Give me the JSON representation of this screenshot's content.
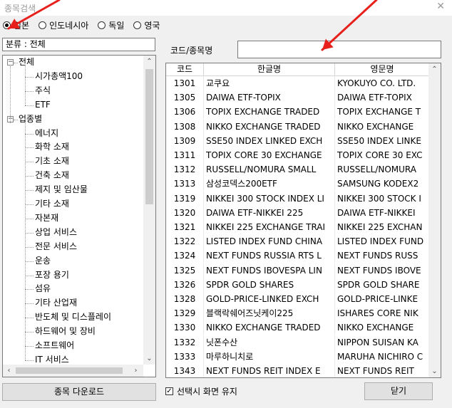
{
  "window": {
    "title": "종목검색"
  },
  "country_radios": [
    {
      "label": "일본",
      "selected": true
    },
    {
      "label": "인도네시아",
      "selected": false
    },
    {
      "label": "독일",
      "selected": false
    },
    {
      "label": "영국",
      "selected": false
    }
  ],
  "category_label": "분류 : 전체",
  "tree": {
    "groups": [
      {
        "label": "전체",
        "expander": "−",
        "children": [
          "시가총액100",
          "주식",
          "ETF"
        ]
      },
      {
        "label": "업종별",
        "expander": "−",
        "children": [
          "에너지",
          "화학 소재",
          "기초 소재",
          "건축 소재",
          "제지 및 임산물",
          "기타 소재",
          "자본재",
          "상업 서비스",
          "전문 서비스",
          "운송",
          "포장 용기",
          "섬유",
          "기타 산업재",
          "반도체 및 디스플레이",
          "하드웨어 및 장비",
          "소프트웨어",
          "IT 서비스"
        ]
      }
    ]
  },
  "download_button": "종목 다운로드",
  "search": {
    "label": "코드/종목명",
    "value": ""
  },
  "grid": {
    "columns": [
      "코드",
      "한글명",
      "영문명"
    ],
    "rows": [
      [
        "1301",
        "교쿠요",
        "KYOKUYO CO. LTD."
      ],
      [
        "1305",
        "DAIWA ETF-TOPIX",
        "DAIWA ETF-TOPIX"
      ],
      [
        "1306",
        "TOPIX EXCHANGE TRADED",
        "TOPIX EXCHANGE T"
      ],
      [
        "1308",
        "NIKKO EXCHANGE TRADED",
        "NIKKO EXCHANGE"
      ],
      [
        "1309",
        "SSE50 INDEX LINKED EXCH",
        "SSE50 INDEX LINKE"
      ],
      [
        "1311",
        "TOPIX CORE 30 EXCHANGE",
        "TOPIX CORE 30 EXC"
      ],
      [
        "1312",
        "RUSSELL/NOMURA SMALL",
        "RUSSELL/NOMURA"
      ],
      [
        "1313",
        "삼성코덱스200ETF",
        "SAMSUNG KODEX2"
      ],
      [
        "1319",
        "NIKKEI 300 STOCK INDEX LI",
        "NIKKEI 300 STOCK I"
      ],
      [
        "1320",
        "DAIWA ETF-NIKKEI 225",
        "DAIWA ETF-NIKKEI"
      ],
      [
        "1321",
        "NIKKEI 225 EXCHANGE TRAI",
        "NIKKEI 225 EXCHAN"
      ],
      [
        "1322",
        "LISTED INDEX FUND CHINA",
        "LISTED INDEX FUND"
      ],
      [
        "1324",
        "NEXT FUNDS RUSSIA RTS L",
        "NEXT FUNDS RUSS"
      ],
      [
        "1325",
        "NEXT FUNDS IBOVESPA LIN",
        "NEXT FUNDS IBOVE"
      ],
      [
        "1326",
        "SPDR GOLD SHARES",
        "SPDR GOLD SHARE"
      ],
      [
        "1328",
        "GOLD-PRICE-LINKED EXCH",
        "GOLD-PRICE-LINKE"
      ],
      [
        "1329",
        "블랙락쉐어즈닛케이225",
        "ISHARES CORE NIK"
      ],
      [
        "1330",
        "NIKKO EXCHANGE TRADED",
        "NIKKO EXCHANGE"
      ],
      [
        "1332",
        "닛폰수산",
        "NIPPON SUISAN KA"
      ],
      [
        "1333",
        "마루하니치로",
        "MARUHA NICHIRO C"
      ],
      [
        "1343",
        "NEXT FUNDS REIT INDEX E",
        "NEXT FUNDS REIT"
      ]
    ]
  },
  "keep_screen_checkbox": {
    "label": "선택시 화면 유지",
    "checked": true
  },
  "close_button": "닫기",
  "colors": {
    "arrow": "#e8201c"
  }
}
